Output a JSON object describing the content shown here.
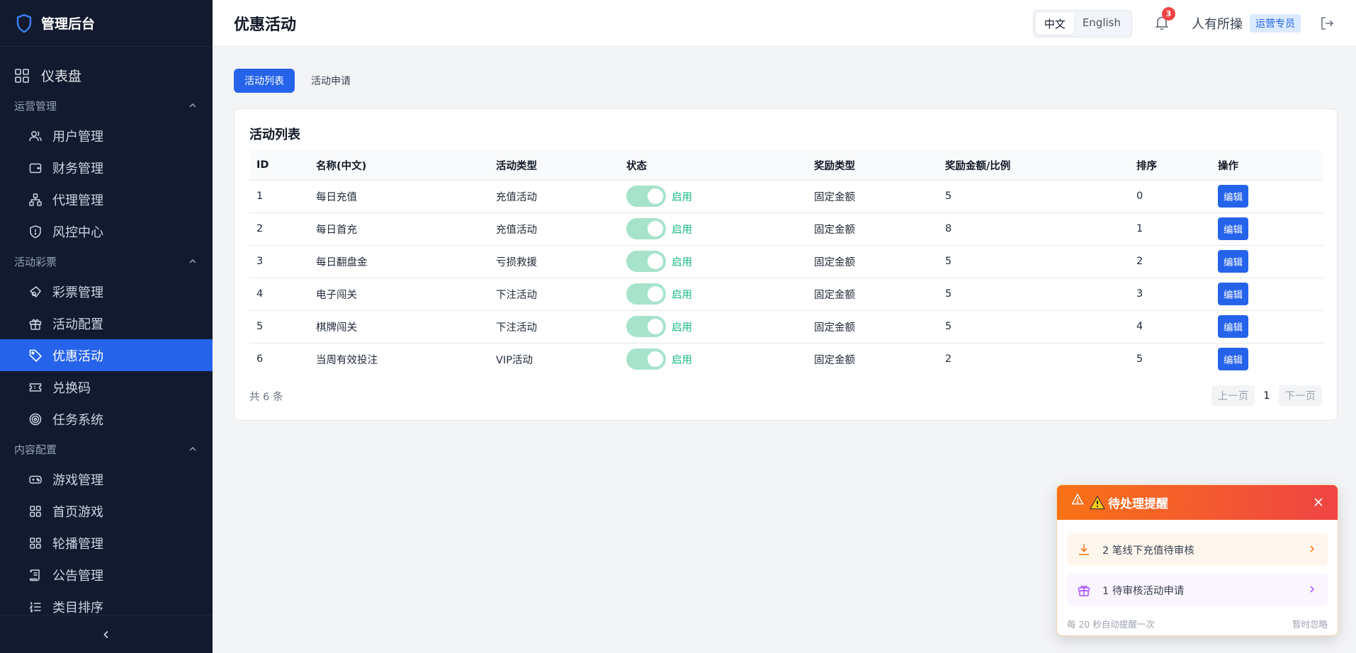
{
  "app": {
    "brand": "管理后台"
  },
  "sidebar": {
    "dashboard": "仪表盘",
    "groups": [
      {
        "title": "运营管理",
        "items": [
          "用户管理",
          "财务管理",
          "代理管理",
          "风控中心"
        ]
      },
      {
        "title": "活动彩票",
        "items": [
          "彩票管理",
          "活动配置",
          "优惠活动",
          "兑换码",
          "任务系统"
        ]
      },
      {
        "title": "内容配置",
        "items": [
          "游戏管理",
          "首页游戏",
          "轮播管理",
          "公告管理",
          "类目排序"
        ]
      }
    ],
    "active": "优惠活动"
  },
  "header": {
    "title": "优惠活动",
    "lang_zh": "中文",
    "lang_en": "English",
    "notifications": "3",
    "user": "人有所操",
    "role": "运营专员"
  },
  "tabs": [
    "活动列表",
    "活动申请"
  ],
  "card": {
    "title": "活动列表",
    "columns": [
      "ID",
      "名称(中文)",
      "活动类型",
      "状态",
      "奖励类型",
      "奖励金额/比例",
      "排序",
      "操作"
    ],
    "rows": [
      {
        "id": "1",
        "name": "每日充值",
        "type": "充值活动",
        "status": "启用",
        "reward_type": "固定金额",
        "amount": "5",
        "sort": "0",
        "action": "编辑"
      },
      {
        "id": "2",
        "name": "每日首充",
        "type": "充值活动",
        "status": "启用",
        "reward_type": "固定金额",
        "amount": "8",
        "sort": "1",
        "action": "编辑"
      },
      {
        "id": "3",
        "name": "每日翻盘金",
        "type": "亏损救援",
        "status": "启用",
        "reward_type": "固定金额",
        "amount": "5",
        "sort": "2",
        "action": "编辑"
      },
      {
        "id": "4",
        "name": "电子闯关",
        "type": "下注活动",
        "status": "启用",
        "reward_type": "固定金额",
        "amount": "5",
        "sort": "3",
        "action": "编辑"
      },
      {
        "id": "5",
        "name": "棋牌闯关",
        "type": "下注活动",
        "status": "启用",
        "reward_type": "固定金额",
        "amount": "5",
        "sort": "4",
        "action": "编辑"
      },
      {
        "id": "6",
        "name": "当周有效投注",
        "type": "VIP活动",
        "status": "启用",
        "reward_type": "固定金额",
        "amount": "2",
        "sort": "5",
        "action": "编辑"
      }
    ],
    "total": "共 6 条",
    "pager": {
      "prev": "上一页",
      "page": "1",
      "next": "下一页"
    }
  },
  "notice": {
    "title": "待处理提醒",
    "items": [
      "2 笔线下充值待审核",
      "1 待审核活动申请"
    ],
    "footer": "每 20 秒自动提醒一次",
    "dismiss": "暂时忽略"
  },
  "colors": {
    "sidebar_bg": "#111a2e",
    "accent": "#2563eb",
    "success": "#10b981",
    "notice_start": "#f97316",
    "notice_end": "#ef4444"
  }
}
